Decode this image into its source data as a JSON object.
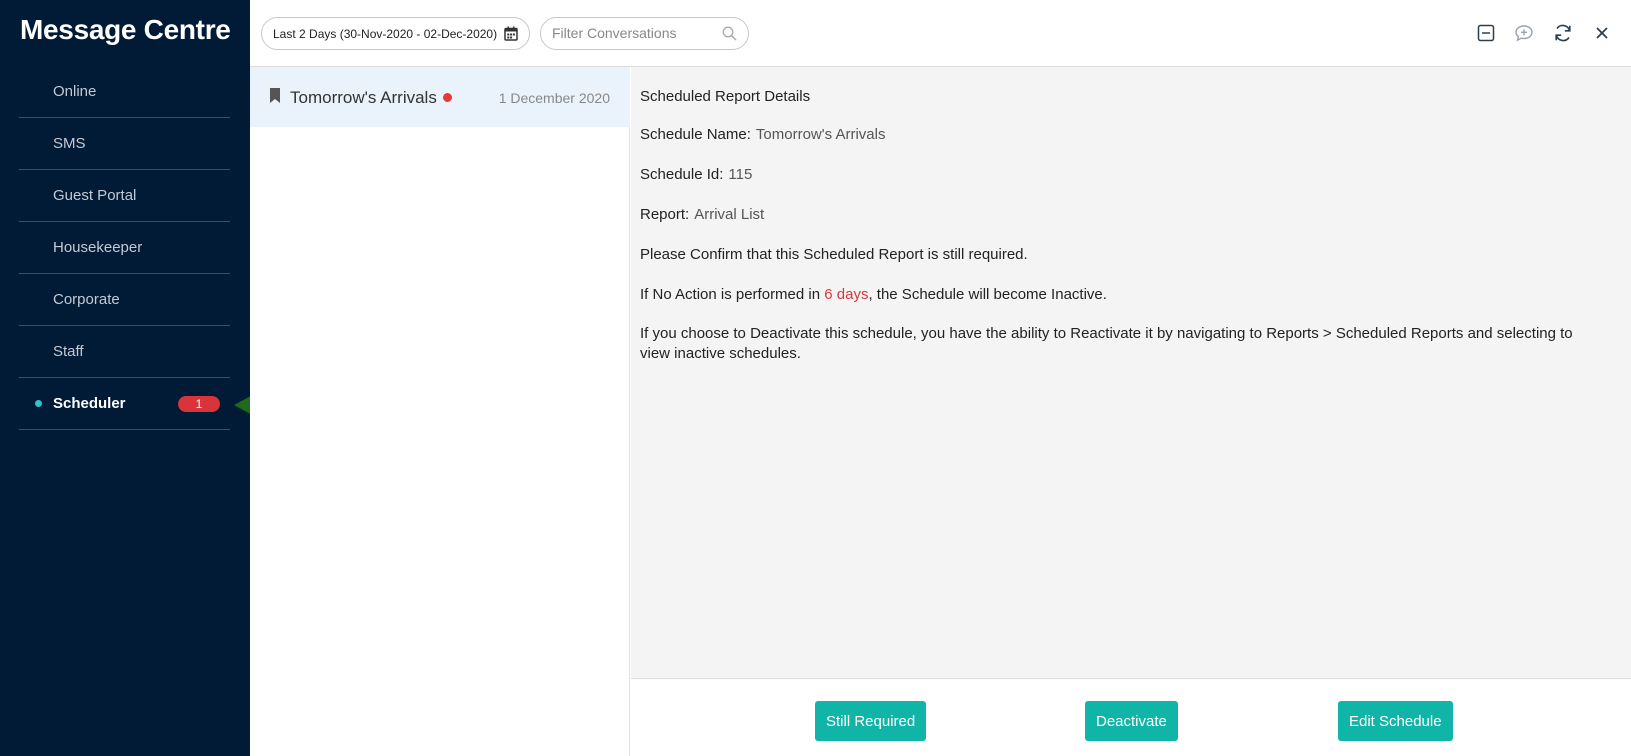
{
  "app": {
    "title": "Message Centre"
  },
  "sidebar": {
    "items": [
      {
        "label": "Online"
      },
      {
        "label": "SMS"
      },
      {
        "label": "Guest Portal"
      },
      {
        "label": "Housekeeper"
      },
      {
        "label": "Corporate"
      },
      {
        "label": "Staff"
      },
      {
        "label": "Scheduler",
        "badge": "1",
        "active": true
      }
    ]
  },
  "toolbar": {
    "date_range": "Last 2 Days (30-Nov-2020 - 02-Dec-2020)",
    "search_placeholder": "Filter Conversations",
    "icons": [
      "calendar-icon",
      "search-icon",
      "minimize-icon",
      "new-message-icon",
      "refresh-icon",
      "close-icon"
    ]
  },
  "conversations": [
    {
      "title": "Tomorrow's Arrivals",
      "date": "1 December 2020",
      "unread": true
    }
  ],
  "detail": {
    "heading": "Scheduled Report Details",
    "schedule_name_label": "Schedule Name:",
    "schedule_name": "Tomorrow's Arrivals",
    "schedule_id_label": "Schedule Id:",
    "schedule_id": "115",
    "report_label": "Report:",
    "report": "Arrival List",
    "confirm_text": "Please Confirm that this Scheduled Report is still required.",
    "inactive_prefix": "If No Action is performed in ",
    "inactive_days": "6 days",
    "inactive_suffix": ", the Schedule will become Inactive.",
    "deactivate_info": "If you choose to Deactivate this schedule, you have the ability to Reactivate it by navigating to Reports > Scheduled Reports and selecting to view inactive schedules."
  },
  "actions": {
    "still_required": "Still Required",
    "deactivate": "Deactivate",
    "edit_schedule": "Edit Schedule"
  },
  "colors": {
    "sidebar_bg": "#011a36",
    "accent": "#11b5a8",
    "badge": "#d9343a",
    "warning_text": "#d43a3a",
    "annotation_arrow": "#1e6b1e"
  }
}
